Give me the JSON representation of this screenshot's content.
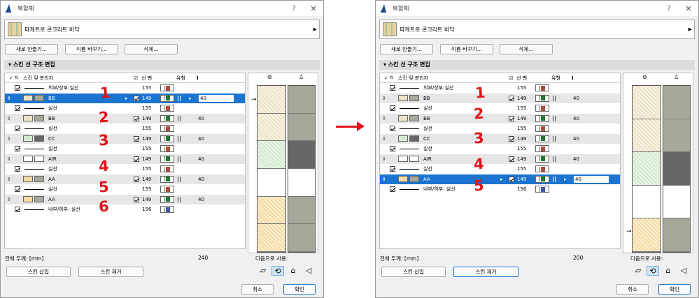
{
  "dialog": {
    "title": "복합체",
    "help": "?",
    "close": "✕",
    "composite_name": "파케트로 콘크리트 바닥",
    "buttons": {
      "new": "새로 만들기...",
      "rename": "이름 바꾸기...",
      "delete": "삭제..."
    },
    "section_title": "스킨 선 구조 편집",
    "headers": {
      "skin": "스킨 및 분리자",
      "pen": "선 펜",
      "type": "유형",
      "thickness_icon": "I"
    },
    "total_label": "전체 두께: [mm]",
    "use_as_label": "다음으로 사용:",
    "insert_skin": "스킨 삽입",
    "remove_skin": "스킨 제거",
    "cancel": "취소",
    "ok": "확인"
  },
  "left": {
    "total_value": "240",
    "rows": [
      {
        "kind": "line",
        "label": "외부/상부:실선",
        "pen": "155",
        "color": "#b04a3a"
      },
      {
        "kind": "skin",
        "label": "BB",
        "pen": "149",
        "color": "#1e7a2e",
        "thick": "40",
        "sw1": "#eee3c7",
        "sw2": "#a7a79a",
        "sel": true
      },
      {
        "kind": "line",
        "label": "실선",
        "pen": "155",
        "color": "#b04a3a"
      },
      {
        "kind": "skin",
        "label": "BB",
        "pen": "149",
        "color": "#1e7a2e",
        "thick": "40",
        "sw1": "#eee3c7",
        "sw2": "#a7a79a"
      },
      {
        "kind": "line",
        "label": "실선",
        "pen": "155",
        "color": "#b04a3a"
      },
      {
        "kind": "skin",
        "label": "CC",
        "pen": "149",
        "color": "#1e7a2e",
        "thick": "40",
        "sw1": "#d4ead0",
        "sw2": "#666666"
      },
      {
        "kind": "line",
        "label": "실선",
        "pen": "155",
        "color": "#b04a3a"
      },
      {
        "kind": "skin",
        "label": "AIR",
        "pen": "149",
        "color": "#1e7a2e",
        "thick": "40",
        "sw1": "#ffffff",
        "sw2": "#ffffff"
      },
      {
        "kind": "line",
        "label": "실선",
        "pen": "155",
        "color": "#b04a3a"
      },
      {
        "kind": "skin",
        "label": "AA",
        "pen": "149",
        "color": "#1e7a2e",
        "thick": "40",
        "sw1": "#f4dca4",
        "sw2": "#a7a79a"
      },
      {
        "kind": "line",
        "label": "실선",
        "pen": "155",
        "color": "#b04a3a"
      },
      {
        "kind": "skin",
        "label": "AA",
        "pen": "149",
        "color": "#1e7a2e",
        "thick": "40",
        "sw1": "#f4dca4",
        "sw2": "#a7a79a"
      },
      {
        "kind": "line",
        "label": "내부/하부: 실선",
        "pen": "156",
        "color": "#3a5aa8"
      }
    ],
    "annotations": [
      "1",
      "2",
      "3",
      "4",
      "5",
      "6"
    ]
  },
  "right": {
    "total_value": "200",
    "rows": [
      {
        "kind": "line",
        "label": "외부/상부:실선",
        "pen": "155",
        "color": "#b04a3a"
      },
      {
        "kind": "skin",
        "label": "BB",
        "pen": "149",
        "color": "#1e7a2e",
        "thick": "40",
        "sw1": "#eee3c7",
        "sw2": "#a7a79a"
      },
      {
        "kind": "line",
        "label": "실선",
        "pen": "155",
        "color": "#b04a3a"
      },
      {
        "kind": "skin",
        "label": "BB",
        "pen": "149",
        "color": "#1e7a2e",
        "thick": "40",
        "sw1": "#eee3c7",
        "sw2": "#a7a79a"
      },
      {
        "kind": "line",
        "label": "실선",
        "pen": "155",
        "color": "#b04a3a"
      },
      {
        "kind": "skin",
        "label": "CC",
        "pen": "149",
        "color": "#1e7a2e",
        "thick": "40",
        "sw1": "#d4ead0",
        "sw2": "#666666"
      },
      {
        "kind": "line",
        "label": "실선",
        "pen": "155",
        "color": "#b04a3a"
      },
      {
        "kind": "skin",
        "label": "AIR",
        "pen": "149",
        "color": "#1e7a2e",
        "thick": "40",
        "sw1": "#ffffff",
        "sw2": "#ffffff"
      },
      {
        "kind": "line",
        "label": "실선",
        "pen": "155",
        "color": "#b04a3a"
      },
      {
        "kind": "skin",
        "label": "AA",
        "pen": "149",
        "color": "#1e7a2e",
        "thick": "40",
        "sw1": "#f4dca4",
        "sw2": "#a7a79a",
        "sel": true
      },
      {
        "kind": "line",
        "label": "내부/하부: 실선",
        "pen": "156",
        "color": "#3a5aa8"
      }
    ],
    "annotations": [
      "1",
      "2",
      "3",
      "4",
      "5"
    ]
  },
  "colors": {
    "selection": "#1b74d0",
    "annotation": "#e1141b"
  }
}
